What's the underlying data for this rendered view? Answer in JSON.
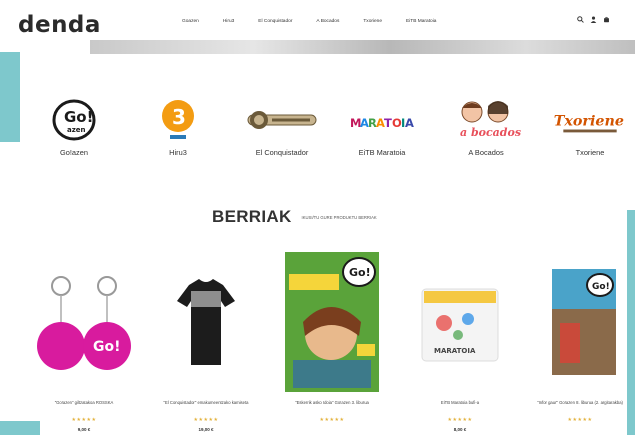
{
  "header": {
    "logo": "denda",
    "nav": [
      "Goazen",
      "Hiru3",
      "El Conquistador",
      "A Bocados",
      "Txoriene",
      "EiTB Maratoia"
    ],
    "tools": {
      "search_icon": "search-icon",
      "user_icon": "user-icon",
      "cart_icon": "cart-icon"
    }
  },
  "brands": [
    {
      "label": "Go!azen",
      "icon": "goazen-logo"
    },
    {
      "label": "Hiru3",
      "icon": "hiru3-logo"
    },
    {
      "label": "El Conquistador",
      "icon": "conquistador-logo"
    },
    {
      "label": "EiTB Maratoia",
      "icon": "maratoia-logo"
    },
    {
      "label": "A Bocados",
      "icon": "abocados-logo"
    },
    {
      "label": "Txoriene",
      "icon": "txoriene-logo"
    }
  ],
  "section": {
    "title": "BERRIAK",
    "subtitle": "IKUSI/TU GURE PRODUKTU BERRIAK"
  },
  "products": [
    {
      "name": "\"Go!azen\" giltzatakoa ROSSKA",
      "stars": "★★★★★",
      "price": "9,00 €"
    },
    {
      "name": "\"El Conquistador\" emakumeentzako kamiseta",
      "stars": "★★★★★",
      "price": "19,00 €"
    },
    {
      "name": "\"Eskerrik asko Idoia\" Go!azen 3. liburua",
      "stars": "★★★★★",
      "price": ""
    },
    {
      "name": "EiTB Maratoia bufi-a",
      "stars": "★★★★★",
      "price": "8,00 €"
    },
    {
      "name": "\"Infor gaur\" Go!azen 8. liburua (2. argitarakba)",
      "stars": "★★★★★",
      "price": ""
    }
  ],
  "colors": {
    "accent_teal": "#7ec8cc",
    "magenta": "#d81b9e",
    "orange": "#f39c12"
  }
}
